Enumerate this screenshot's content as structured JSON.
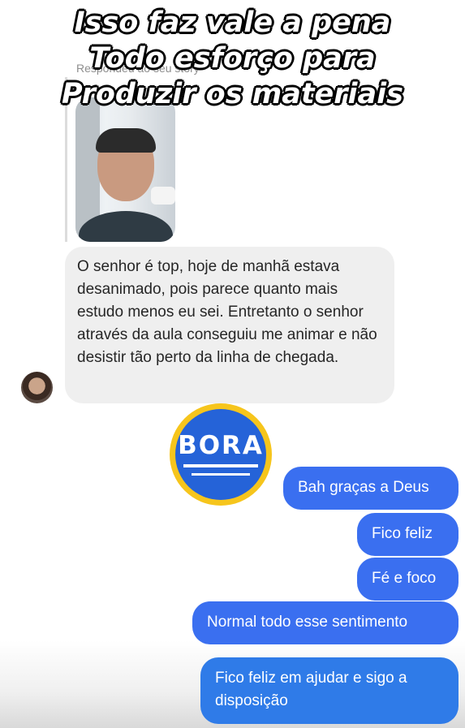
{
  "caption": {
    "line1": "Isso faz vale a pena",
    "line2": "Todo esforço para",
    "line3": "Produzir os materiais"
  },
  "story": {
    "label": "Respondeu ao seu story"
  },
  "received_message": {
    "text": "O senhor é top, hoje de manhã estava desanimado, pois parece quanto mais estudo menos eu sei. Entretanto o senhor através da aula conseguiu me animar e não desistir tão perto da linha de chegada."
  },
  "sticker": {
    "text": "BORA",
    "colors": {
      "ring": "#f6c51c",
      "fill": "#2563d8"
    }
  },
  "sent_messages": [
    {
      "text": "Bah graças a Deus"
    },
    {
      "text": "Fico feliz"
    },
    {
      "text": "Fé e foco"
    },
    {
      "text": "Normal todo esse sentimento"
    },
    {
      "text": "Fico feliz em ajudar e sigo a disposição"
    }
  ],
  "colors": {
    "sent_bubble": "#3a6ff0",
    "received_bubble": "#efefef"
  }
}
